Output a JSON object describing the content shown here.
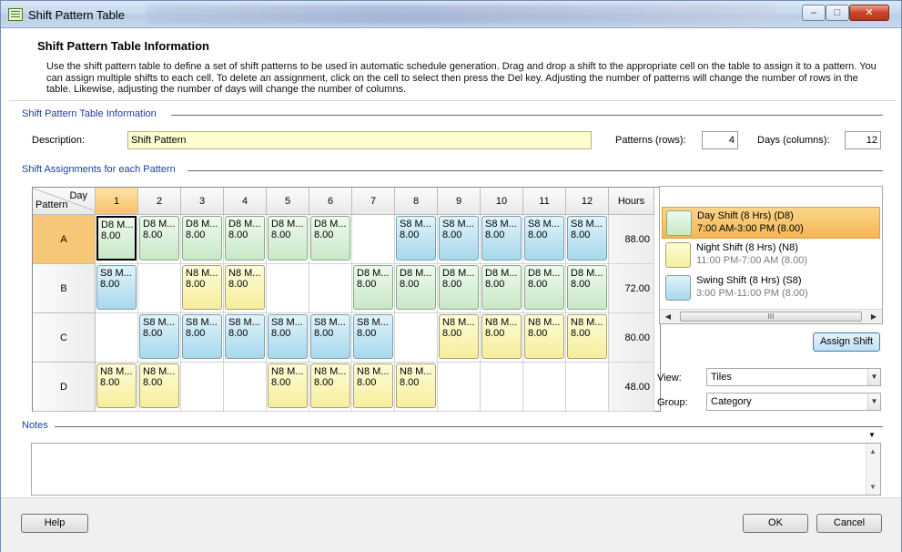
{
  "window": {
    "title": "Shift Pattern Table"
  },
  "header": {
    "title": "Shift Pattern Table Information",
    "description": "Use the shift pattern table to define a set of shift patterns to be used in automatic schedule generation. Drag and drop a shift to the appropriate cell on the table to assign it to a pattern. You can assign multiple shifts to each cell. To delete an assignment, click on the cell to select then press the Del key.  Adjusting the number of patterns will change the number of rows in the table. Likewise, adjusting the number of days will change the number of columns."
  },
  "info_group": {
    "label": "Shift Pattern Table Information",
    "description_label": "Description:",
    "description_value": "Shift Pattern",
    "patterns_label": "Patterns (rows):",
    "patterns_value": "4",
    "days_label": "Days (columns):",
    "days_value": "12"
  },
  "assign_group": {
    "label": "Shift Assignments for each Pattern"
  },
  "grid": {
    "corner_day": "Day",
    "corner_pattern": "Pattern",
    "hours_header": "Hours",
    "days": [
      "1",
      "2",
      "3",
      "4",
      "5",
      "6",
      "7",
      "8",
      "9",
      "10",
      "11",
      "12"
    ],
    "rows": [
      {
        "name": "A",
        "hours": "88.00",
        "cells": [
          "D",
          "D",
          "D",
          "D",
          "D",
          "D",
          "",
          "S",
          "S",
          "S",
          "S",
          "S"
        ]
      },
      {
        "name": "B",
        "hours": "72.00",
        "cells": [
          "S",
          "",
          "N",
          "N",
          "",
          "",
          "D",
          "D",
          "D",
          "D",
          "D",
          "D"
        ]
      },
      {
        "name": "C",
        "hours": "80.00",
        "cells": [
          "",
          "S",
          "S",
          "S",
          "S",
          "S",
          "S",
          "",
          "N",
          "N",
          "N",
          "N"
        ]
      },
      {
        "name": "D",
        "hours": "48.00",
        "cells": [
          "N",
          "N",
          "",
          "",
          "N",
          "N",
          "N",
          "N",
          "",
          "",
          "",
          ""
        ]
      }
    ],
    "tile_labels": {
      "D": "D8 M...",
      "N": "N8 M...",
      "S": "S8 M..."
    },
    "tile_value": "8.00",
    "colors": {
      "D": "#c8e8c6",
      "N": "#f6ee9c",
      "S": "#a8d8ec"
    }
  },
  "shifts": [
    {
      "code": "D",
      "name": "Day Shift (8 Hrs) (D8)",
      "time": "7:00 AM-3:00 PM (8.00)",
      "selected": true
    },
    {
      "code": "N",
      "name": "Night Shift (8 Hrs) (N8)",
      "time": "11:00 PM-7:00 AM (8.00)",
      "selected": false
    },
    {
      "code": "S",
      "name": "Swing Shift (8 Hrs) (S8)",
      "time": "3:00 PM-11:00 PM (8.00)",
      "selected": false
    }
  ],
  "scroll_thumb": "III",
  "buttons": {
    "assign_shift": "Assign Shift",
    "help": "Help",
    "ok": "OK",
    "cancel": "Cancel"
  },
  "view": {
    "label": "View:",
    "value": "Tiles"
  },
  "group": {
    "label": "Group:",
    "value": "Category"
  },
  "notes": {
    "label": "Notes"
  }
}
